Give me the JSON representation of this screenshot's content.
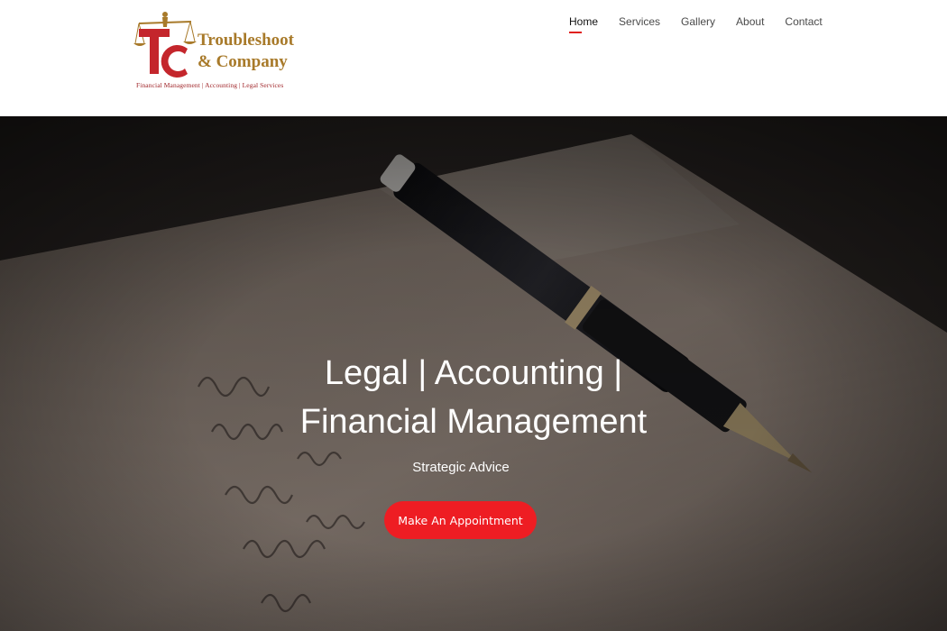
{
  "brand": {
    "name_line1": "Troubleshoot",
    "name_line2": "& Company",
    "tagline": "Financial Management   | Accounting |  Legal Services",
    "colors": {
      "gold": "#a87a2a",
      "red": "#c4262c"
    }
  },
  "nav": {
    "items": [
      {
        "label": "Home",
        "active": true
      },
      {
        "label": "Services"
      },
      {
        "label": "Gallery"
      },
      {
        "label": "About"
      },
      {
        "label": "Contact"
      }
    ]
  },
  "hero": {
    "title": "Legal | Accounting | Financial Management",
    "subtitle": "Strategic Advice",
    "cta_label": "Make An Appointment",
    "accent": "#ee1d23",
    "background": "fountain-pen-on-handwritten-paper"
  }
}
